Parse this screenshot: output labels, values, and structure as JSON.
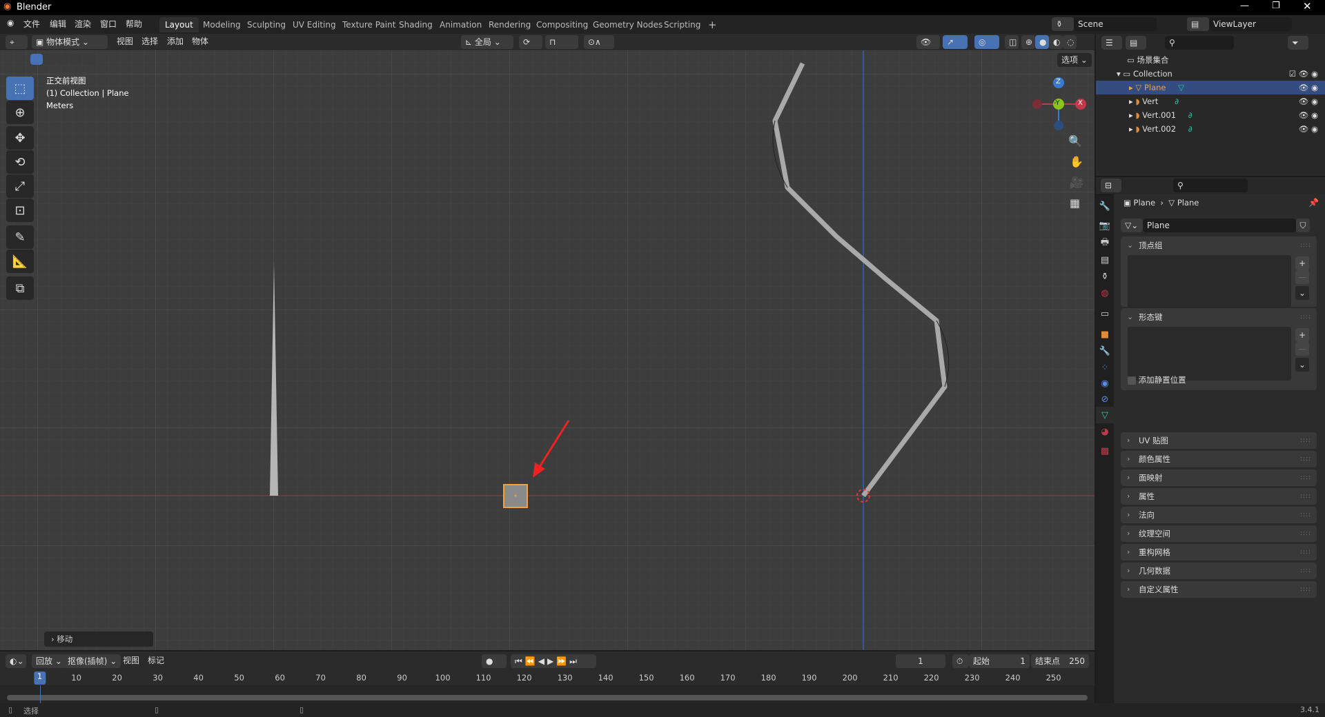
{
  "title": "Blender",
  "menu": [
    "文件",
    "编辑",
    "渲染",
    "窗口",
    "帮助"
  ],
  "workspaces": [
    "Layout",
    "Modeling",
    "Sculpting",
    "UV Editing",
    "Texture Paint",
    "Shading",
    "Animation",
    "Rendering",
    "Compositing",
    "Geometry Nodes",
    "Scripting"
  ],
  "add_workspace": "+",
  "scene": "Scene",
  "view_layer": "ViewLayer",
  "viewport_header": {
    "mode": "物体模式",
    "menus": [
      "视图",
      "选择",
      "添加",
      "物体"
    ],
    "orientation": "全局",
    "options": "选项"
  },
  "viewport_overlay": {
    "view": "正交前视图",
    "collection": "(1) Collection | Plane",
    "units": "Meters"
  },
  "gizmo": {
    "z": "Z",
    "y": "-Y",
    "x": "X"
  },
  "last_op": "移动",
  "outliner": {
    "root": "场景集合",
    "collection": "Collection",
    "items": [
      {
        "name": "Plane",
        "selected": true
      },
      {
        "name": "Vert"
      },
      {
        "name": "Vert.001"
      },
      {
        "name": "Vert.002"
      }
    ]
  },
  "properties": {
    "breadcrumb": [
      "Plane",
      "Plane"
    ],
    "mesh_name": "Plane",
    "vertex_groups": "顶点组",
    "shape_keys": "形态键",
    "add_rest": "添加静置位置",
    "panels": [
      "UV 贴图",
      "颜色属性",
      "面映射",
      "属性",
      "法向",
      "纹理空间",
      "重构网格",
      "几何数据",
      "自定义属性"
    ]
  },
  "timeline": {
    "menus": [
      "回放",
      "抠像(插帧)",
      "视图",
      "标记"
    ],
    "current_frame": "1",
    "start_label": "起始",
    "start": "1",
    "end_label": "结束点",
    "end": "250",
    "ticks": [
      1,
      10,
      20,
      30,
      40,
      50,
      60,
      70,
      80,
      90,
      100,
      110,
      120,
      130,
      140,
      150,
      160,
      170,
      180,
      190,
      200,
      210,
      220,
      230,
      240,
      250
    ]
  },
  "status": {
    "select": "选择",
    "version": "3.4.1"
  },
  "colors": {
    "accent": "#4772b3",
    "selected_orange": "#f5a142",
    "x_axis": "#c2394b",
    "z_axis": "#3a79d0"
  }
}
